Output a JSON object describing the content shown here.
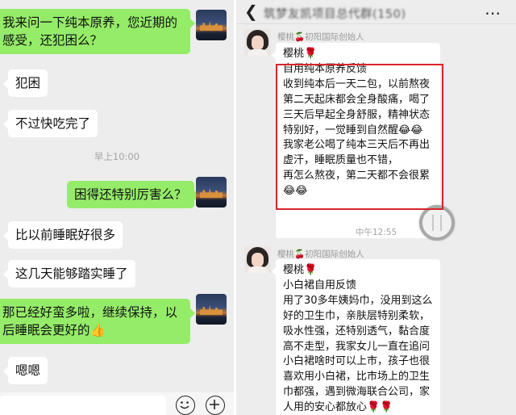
{
  "left_chat": {
    "messages": [
      {
        "side": "out",
        "text": "我来问一下纯本原养，您近期的感受，还犯困么？"
      },
      {
        "side": "in",
        "text": "犯困"
      },
      {
        "side": "in",
        "text": "不过快吃完了"
      },
      {
        "side": "out",
        "text": "困得还特别厉害么？"
      },
      {
        "side": "in",
        "text": "比以前睡眠好很多"
      },
      {
        "side": "in",
        "text": "这几天能够踏实睡了"
      },
      {
        "side": "out",
        "text": "那已经好蛮多啦，继续保持，以后睡眠会更好的👍"
      },
      {
        "side": "in",
        "text": "嗯嗯"
      }
    ],
    "timestamp": "早上10:00",
    "icons": [
      "emoji-icon",
      "plus-icon"
    ]
  },
  "right_chat": {
    "header": {
      "title": "筑梦友凯项目总代群(150)",
      "back_icon": "back-chevron-icon",
      "more_icon": "more-dots-icon"
    },
    "timestamp": "中午12:55",
    "posts": [
      {
        "sender": "樱桃🍒初阳国际创始人",
        "name_line": "樱桃🌹",
        "lines": [
          "自用纯本原养反馈",
          "收到纯本后一天二包，以前熬夜",
          "第二天起床都会全身酸痛，喝了",
          "三天后早起全身舒服，精神状态",
          "特别好，一觉睡到自然醒😂😂",
          "我家老公喝了纯本三天后不再出",
          "虚汗，睡眠质量也不错，",
          "再怎么熬夜，第二天都不会很累",
          "😂😂"
        ]
      },
      {
        "sender": "樱桃🍒初阳国际创始人",
        "name_line": "樱桃🌹",
        "lines": [
          "小白裙自用反馈",
          "用了30多年姨妈巾，没用到这么",
          "好的卫生巾，亲肤层特别柔软，",
          "吸水性强，还特别透气，黏合度",
          "高不走型，我家女儿一直在追问",
          "小白裙啥时可以上市，孩子也很",
          "喜欢用小白裙，比市场上的卫生",
          "巾都强，遇到微海联合公司，家",
          "人用的安心都放心🌹🌹"
        ]
      }
    ],
    "highlight_color": "#d9242b"
  },
  "colors": {
    "outgoing_bubble": "#95ec69",
    "incoming_bubble": "#ffffff",
    "chat_background": "#ededed"
  }
}
